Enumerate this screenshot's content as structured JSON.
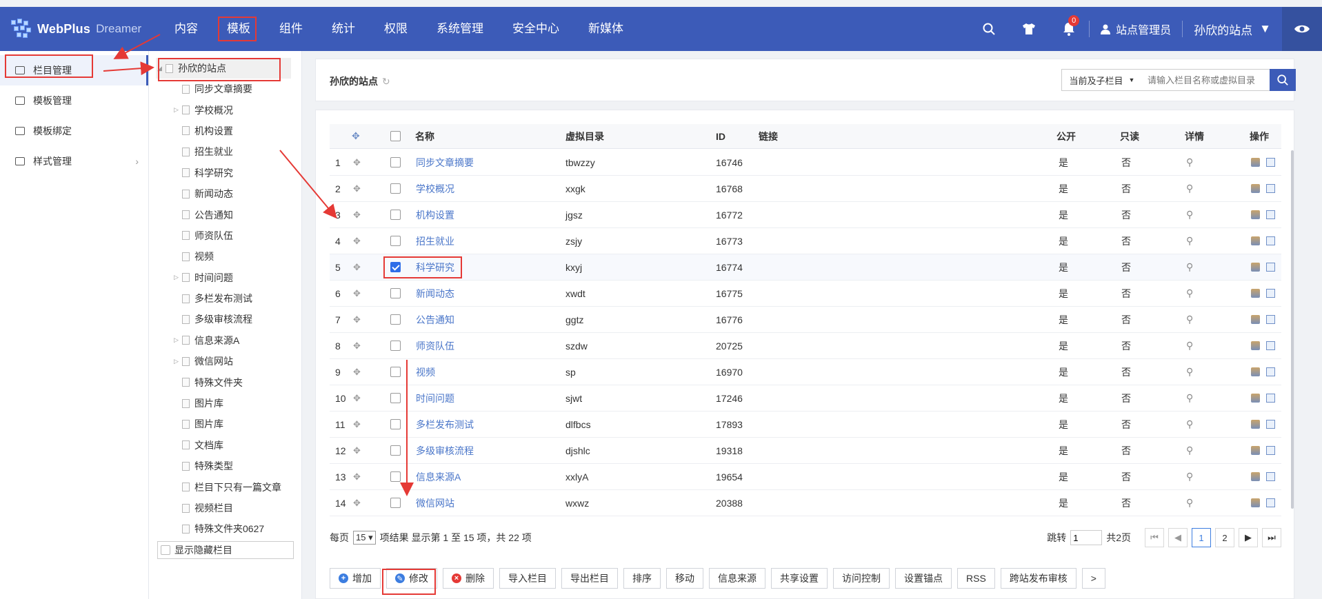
{
  "brand": {
    "name": "WebPlus",
    "sub": "Dreamer"
  },
  "nav": [
    "内容",
    "模板",
    "组件",
    "统计",
    "权限",
    "系统管理",
    "安全中心",
    "新媒体"
  ],
  "header": {
    "notifications": "0",
    "user": "站点管理员",
    "site": "孙欣的站点"
  },
  "left_menu": [
    {
      "label": "栏目管理",
      "icon": "column-manage-icon"
    },
    {
      "label": "模板管理",
      "icon": "template-manage-icon"
    },
    {
      "label": "模板绑定",
      "icon": "template-bind-icon"
    },
    {
      "label": "样式管理",
      "icon": "style-manage-icon"
    }
  ],
  "tree": {
    "root": "孙欣的站点",
    "items": [
      {
        "label": "同步文章摘要",
        "expandable": false
      },
      {
        "label": "学校概况",
        "expandable": true
      },
      {
        "label": "机构设置",
        "expandable": false
      },
      {
        "label": "招生就业",
        "expandable": false
      },
      {
        "label": "科学研究",
        "expandable": false
      },
      {
        "label": "新闻动态",
        "expandable": false
      },
      {
        "label": "公告通知",
        "expandable": false
      },
      {
        "label": "师资队伍",
        "expandable": false
      },
      {
        "label": "视频",
        "expandable": false
      },
      {
        "label": "时间问题",
        "expandable": true
      },
      {
        "label": "多栏发布测试",
        "expandable": false
      },
      {
        "label": "多级审核流程",
        "expandable": false
      },
      {
        "label": "信息来源A",
        "expandable": true
      },
      {
        "label": "微信网站",
        "expandable": true
      },
      {
        "label": "特殊文件夹",
        "expandable": false
      },
      {
        "label": "图片库",
        "expandable": false
      },
      {
        "label": "图片库",
        "expandable": false
      },
      {
        "label": "文档库",
        "expandable": false
      },
      {
        "label": "特殊类型",
        "expandable": false
      },
      {
        "label": "栏目下只有一篇文章",
        "expandable": false
      },
      {
        "label": "视频栏目",
        "expandable": false
      },
      {
        "label": "特殊文件夹0627",
        "expandable": false
      }
    ],
    "show_hidden": "显示隐藏栏目"
  },
  "breadcrumb": {
    "title": "孙欣的站点",
    "scope": "当前及子栏目",
    "search_placeholder": "请输入栏目名称或虚拟目录"
  },
  "table": {
    "headers": {
      "name": "名称",
      "vdir": "虚拟目录",
      "id": "ID",
      "link": "链接",
      "public": "公开",
      "readonly": "只读",
      "detail": "详情",
      "ops": "操作"
    },
    "rows": [
      {
        "no": "1",
        "name": "同步文章摘要",
        "vdir": "tbwzzy",
        "id": "16746",
        "public": "是",
        "readonly": "否",
        "checked": false
      },
      {
        "no": "2",
        "name": "学校概况",
        "vdir": "xxgk",
        "id": "16768",
        "public": "是",
        "readonly": "否",
        "checked": false
      },
      {
        "no": "3",
        "name": "机构设置",
        "vdir": "jgsz",
        "id": "16772",
        "public": "是",
        "readonly": "否",
        "checked": false
      },
      {
        "no": "4",
        "name": "招生就业",
        "vdir": "zsjy",
        "id": "16773",
        "public": "是",
        "readonly": "否",
        "checked": false
      },
      {
        "no": "5",
        "name": "科学研究",
        "vdir": "kxyj",
        "id": "16774",
        "public": "是",
        "readonly": "否",
        "checked": true
      },
      {
        "no": "6",
        "name": "新闻动态",
        "vdir": "xwdt",
        "id": "16775",
        "public": "是",
        "readonly": "否",
        "checked": false
      },
      {
        "no": "7",
        "name": "公告通知",
        "vdir": "ggtz",
        "id": "16776",
        "public": "是",
        "readonly": "否",
        "checked": false
      },
      {
        "no": "8",
        "name": "师资队伍",
        "vdir": "szdw",
        "id": "20725",
        "public": "是",
        "readonly": "否",
        "checked": false
      },
      {
        "no": "9",
        "name": "视频",
        "vdir": "sp",
        "id": "16970",
        "public": "是",
        "readonly": "否",
        "checked": false
      },
      {
        "no": "10",
        "name": "时间问题",
        "vdir": "sjwt",
        "id": "17246",
        "public": "是",
        "readonly": "否",
        "checked": false
      },
      {
        "no": "11",
        "name": "多栏发布测试",
        "vdir": "dlfbcs",
        "id": "17893",
        "public": "是",
        "readonly": "否",
        "checked": false
      },
      {
        "no": "12",
        "name": "多级审核流程",
        "vdir": "djshlc",
        "id": "19318",
        "public": "是",
        "readonly": "否",
        "checked": false
      },
      {
        "no": "13",
        "name": "信息来源A",
        "vdir": "xxlyA",
        "id": "19654",
        "public": "是",
        "readonly": "否",
        "checked": false
      },
      {
        "no": "14",
        "name": "微信网站",
        "vdir": "wxwz",
        "id": "20388",
        "public": "是",
        "readonly": "否",
        "checked": false
      }
    ]
  },
  "pager": {
    "per_page_label": "每页",
    "per_page": "15",
    "summary": "项结果 显示第 1 至 15 项，共 22 项",
    "jump_label": "跳转",
    "jump_value": "1",
    "total_pages": "共2页",
    "pages": [
      "1",
      "2"
    ]
  },
  "toolbar": [
    "增加",
    "修改",
    "删除",
    "导入栏目",
    "导出栏目",
    "排序",
    "移动",
    "信息来源",
    "共享设置",
    "访问控制",
    "设置锚点",
    "RSS",
    "跨站发布审核",
    ">"
  ]
}
